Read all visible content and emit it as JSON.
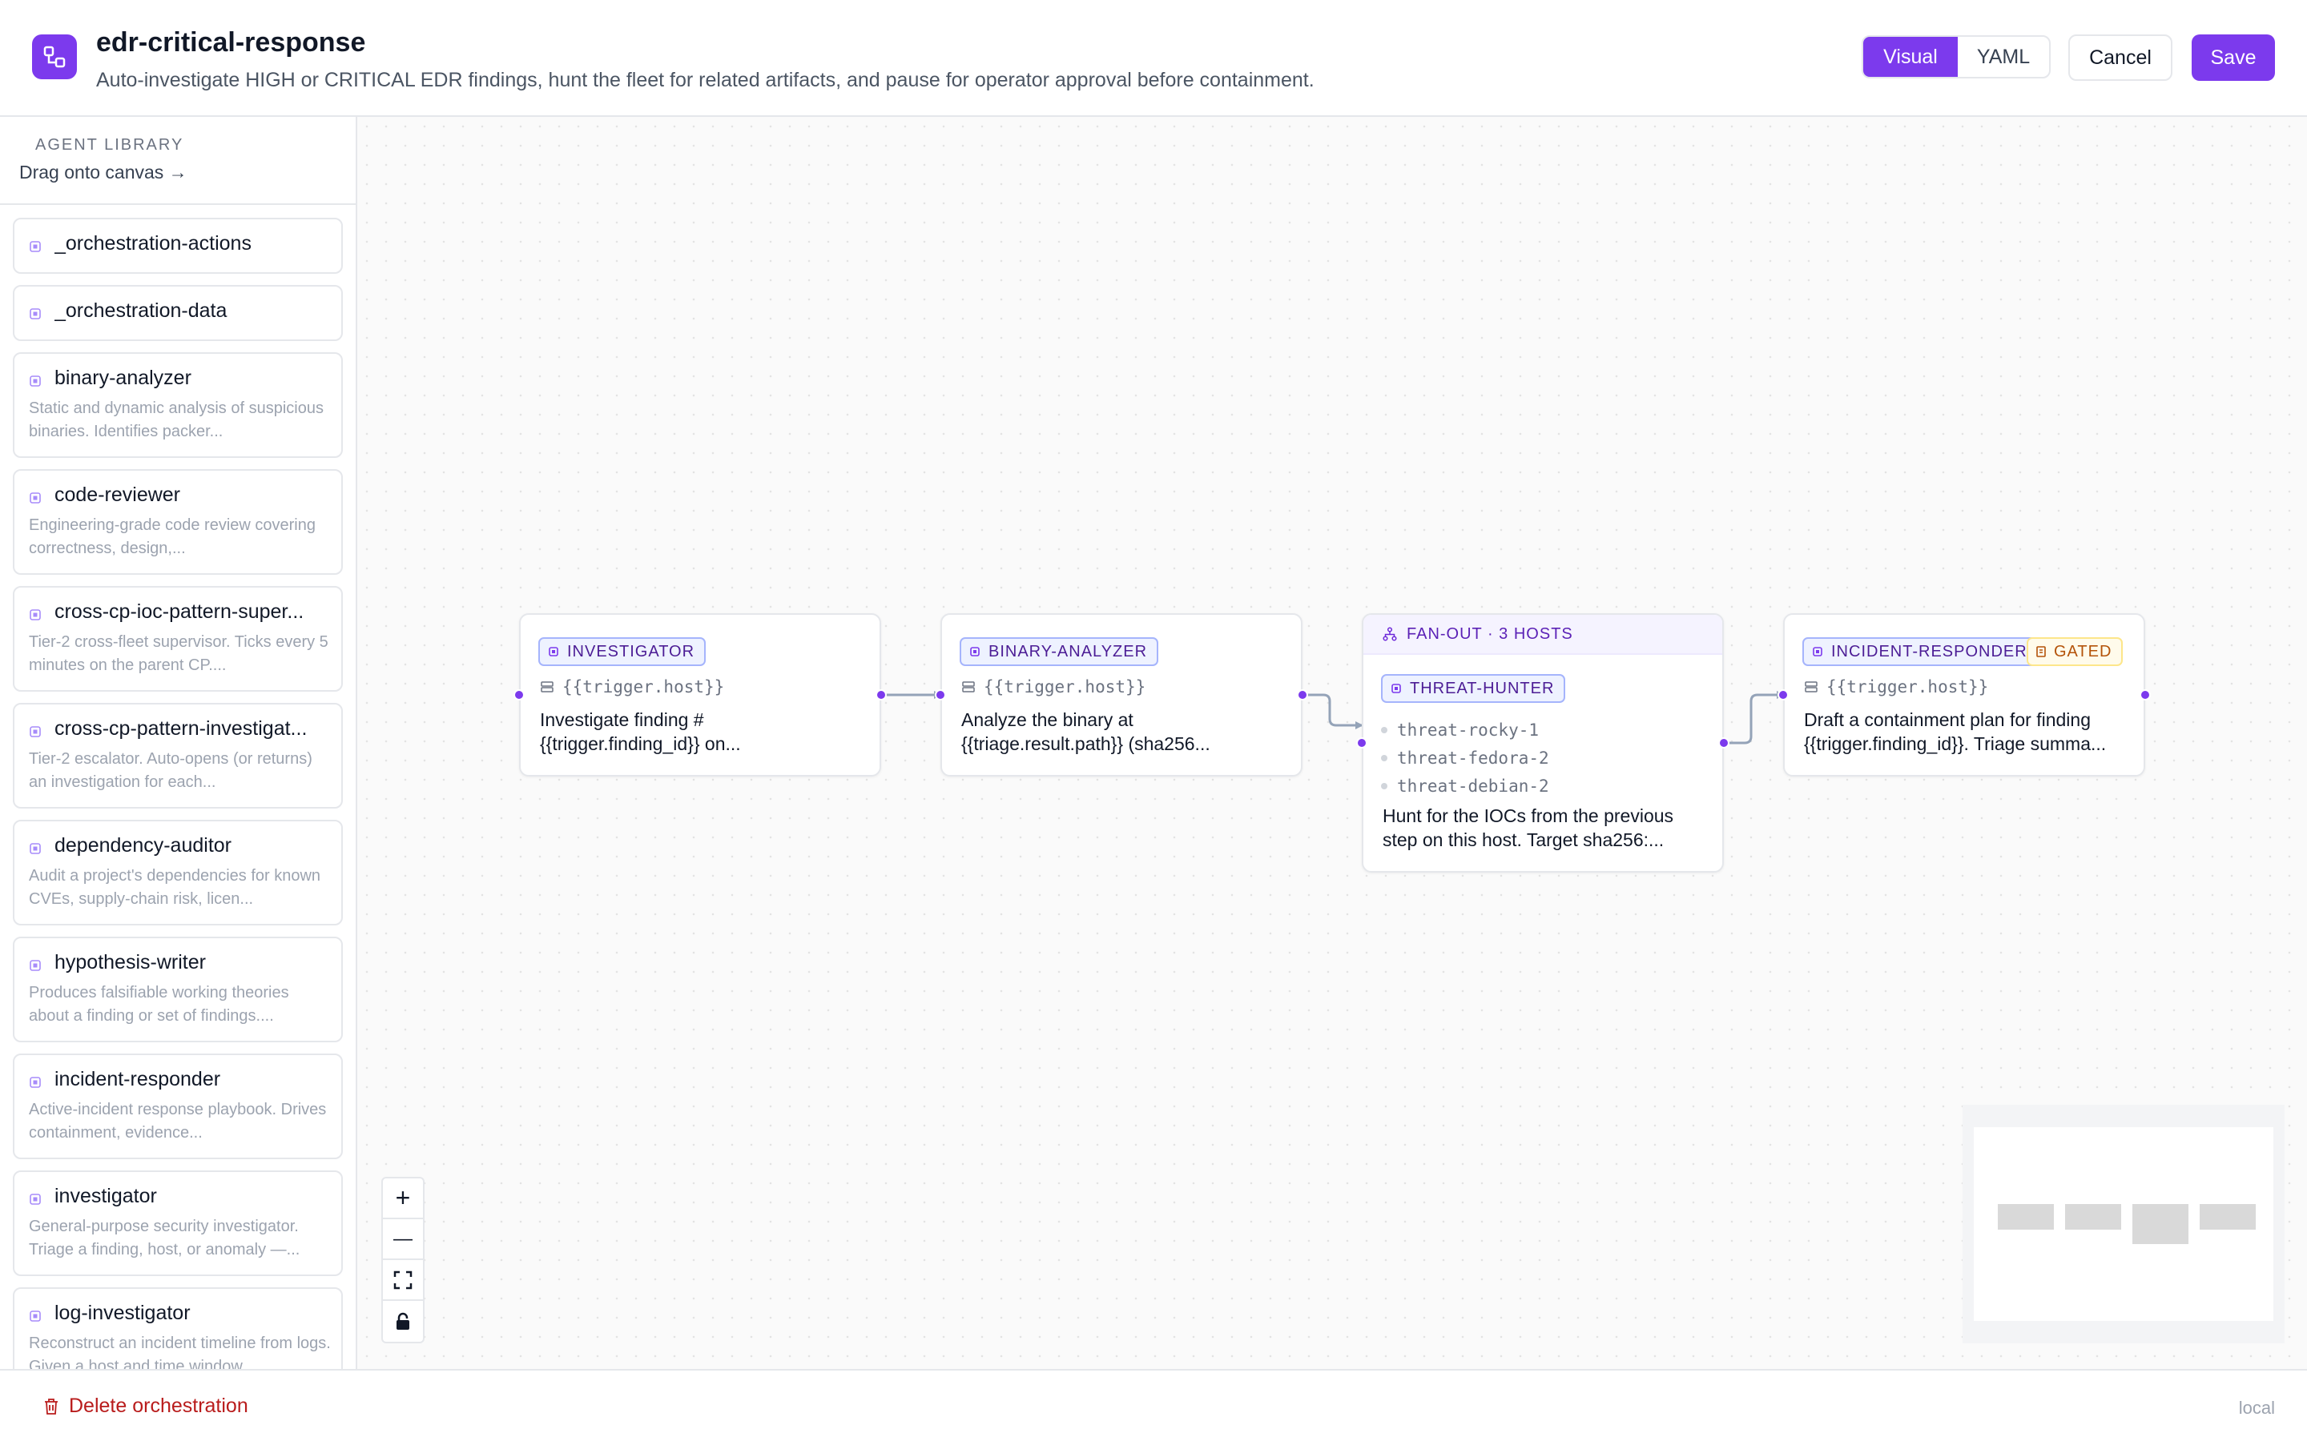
{
  "header": {
    "title": "edr-critical-response",
    "subtitle": "Auto-investigate HIGH or CRITICAL EDR findings, hunt the fleet for related artifacts, and pause for operator approval before containment.",
    "mode_visual": "Visual",
    "mode_yaml": "YAML",
    "active_mode": "Visual",
    "cancel_label": "Cancel",
    "save_label": "Save"
  },
  "sidebar": {
    "title": "AGENT LIBRARY",
    "hint": "Drag onto canvas →",
    "agents": [
      {
        "name": "_orchestration-actions",
        "desc": ""
      },
      {
        "name": "_orchestration-data",
        "desc": ""
      },
      {
        "name": "binary-analyzer",
        "desc": "Static and dynamic analysis of suspicious binaries. Identifies packer..."
      },
      {
        "name": "code-reviewer",
        "desc": "Engineering-grade code review covering correctness, design,..."
      },
      {
        "name": "cross-cp-ioc-pattern-super...",
        "desc": "Tier-2 cross-fleet supervisor. Ticks every 5 minutes on the parent CP...."
      },
      {
        "name": "cross-cp-pattern-investigat...",
        "desc": "Tier-2 escalator. Auto-opens (or returns) an investigation for each..."
      },
      {
        "name": "dependency-auditor",
        "desc": "Audit a project's dependencies for known CVEs, supply-chain risk, licen..."
      },
      {
        "name": "hypothesis-writer",
        "desc": "Produces falsifiable working theories about a finding or set of findings...."
      },
      {
        "name": "incident-responder",
        "desc": "Active-incident response playbook. Drives containment, evidence..."
      },
      {
        "name": "investigator",
        "desc": "General-purpose security investigator. Triage a finding, host, or anomaly —..."
      },
      {
        "name": "log-investigator",
        "desc": "Reconstruct an incident timeline from logs. Given a host and time window,..."
      }
    ]
  },
  "canvas": {
    "nodes": {
      "investigator": {
        "badge": "INVESTIGATOR",
        "host": "{{trigger.host}}",
        "prompt": "Investigate finding # {{trigger.finding_id}} on..."
      },
      "binary_analyzer": {
        "badge": "BINARY-ANALYZER",
        "host": "{{trigger.host}}",
        "prompt": "Analyze the binary at {{triage.result.path}} (sha256..."
      },
      "fanout": {
        "header": "FAN-OUT · 3 HOSTS",
        "badge": "THREAT-HUNTER",
        "hosts": [
          "threat-rocky-1",
          "threat-fedora-2",
          "threat-debian-2"
        ],
        "prompt": "Hunt for the IOCs from the previous step on this host. Target sha256:..."
      },
      "incident_responder": {
        "badge": "INCIDENT-RESPONDER",
        "gated": "GATED",
        "host": "{{trigger.host}}",
        "prompt": "Draft a containment plan for finding {{trigger.finding_id}}. Triage summa..."
      }
    },
    "zoom_controls": [
      "+",
      "—"
    ]
  },
  "footer": {
    "delete_label": "Delete orchestration",
    "environment": "local"
  },
  "colors": {
    "accent": "#7c3aed",
    "badge_border": "#a5b4fc",
    "gated": "#b45309",
    "danger": "#b91c1c"
  },
  "icons": [
    "workflow-icon",
    "agent-chip-icon",
    "server-icon",
    "fan-out-icon",
    "lock-icon",
    "trash-icon",
    "fit-view-icon",
    "plus-icon",
    "minus-icon"
  ]
}
